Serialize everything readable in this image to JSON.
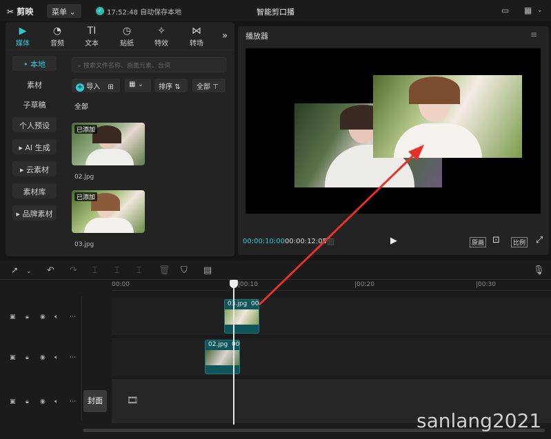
{
  "header": {
    "logo": "剪映",
    "menu_label": "菜单",
    "save_status": "17:52:48 自动保存本地",
    "project_title": "智能剪口播"
  },
  "media_tabs": [
    {
      "label": "媒体",
      "icon": "media-icon",
      "active": true
    },
    {
      "label": "音频",
      "icon": "audio-icon"
    },
    {
      "label": "文本",
      "icon": "text-icon"
    },
    {
      "label": "贴纸",
      "icon": "sticker-icon"
    },
    {
      "label": "特效",
      "icon": "effects-icon"
    },
    {
      "label": "转场",
      "icon": "transition-icon"
    }
  ],
  "sidebar": {
    "items": [
      {
        "label": "本地",
        "active": true
      },
      {
        "label": "素材"
      },
      {
        "label": "子草稿"
      },
      {
        "label": "个人预设"
      },
      {
        "label": "AI 生成"
      },
      {
        "label": "云素材"
      },
      {
        "label": "素材库"
      },
      {
        "label": "品牌素材"
      }
    ]
  },
  "library": {
    "search_placeholder": "搜索文件名称、画面元素、台词",
    "import_label": "导入",
    "sort_label": "排序",
    "filter_label": "全部",
    "section_label": "全部",
    "files": [
      {
        "name": "02.jpg",
        "badge": "已添加"
      },
      {
        "name": "03.jpg",
        "badge": "已添加"
      }
    ]
  },
  "player": {
    "title": "播放器",
    "current_time": "00:00:10:00",
    "total_time": "00:00:12:05",
    "original_label": "原画",
    "ratio_label": "比例"
  },
  "timeline": {
    "ruler_ticks": [
      "00:00",
      "|00:10",
      "|00:20",
      "|00:30"
    ],
    "clips": [
      {
        "name": "03.jpg",
        "duration": "00:"
      },
      {
        "name": "02.jpg",
        "duration": "00:"
      }
    ],
    "cover_label": "封面"
  },
  "watermark": "sanlang2021",
  "colors": {
    "accent": "#2ecad4",
    "clip": "#0f5559",
    "arrow": "#e8302a"
  }
}
